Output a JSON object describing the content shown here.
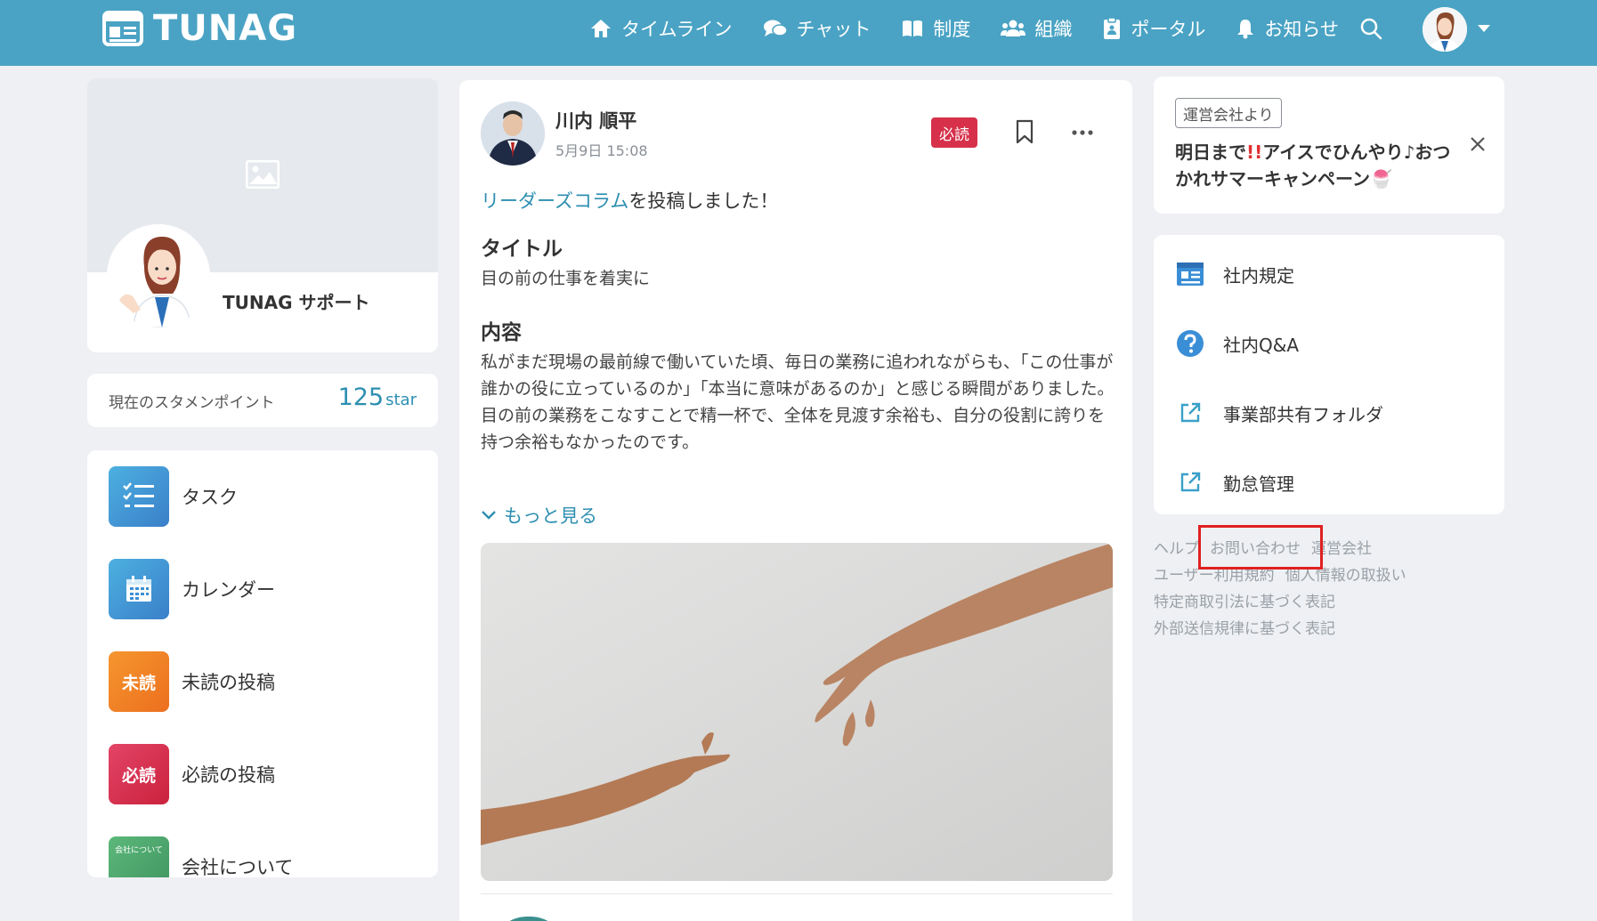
{
  "app": {
    "logo_text": "TUNAG"
  },
  "nav": {
    "items": [
      {
        "label": "タイムライン",
        "icon": "home-icon"
      },
      {
        "label": "チャット",
        "icon": "chat-icon"
      },
      {
        "label": "制度",
        "icon": "book-icon"
      },
      {
        "label": "組織",
        "icon": "people-icon"
      },
      {
        "label": "ポータル",
        "icon": "portal-icon"
      },
      {
        "label": "お知らせ",
        "icon": "bell-icon"
      }
    ]
  },
  "profile": {
    "name": "TUNAG サポート"
  },
  "points": {
    "label": "現在のスタメンポイント",
    "value": "125",
    "unit": "star"
  },
  "menu": {
    "items": [
      {
        "label": "タスク",
        "icon": "task-icon",
        "badge": "",
        "color": "#3d8fd1"
      },
      {
        "label": "カレンダー",
        "icon": "calendar-icon",
        "badge": "",
        "color": "#3a8ed6"
      },
      {
        "label": "未読の投稿",
        "icon": "unread-icon",
        "badge": "未読",
        "color": "#ef7d22"
      },
      {
        "label": "必読の投稿",
        "icon": "must-read-icon",
        "badge": "必読",
        "color": "#d6304a"
      },
      {
        "label": "会社について",
        "icon": "company-icon",
        "badge": "会社について",
        "color": "#4fa86b"
      }
    ]
  },
  "post": {
    "author": "川内 順平",
    "date": "5月9日 15:08",
    "must_badge": "必読",
    "intro_link": "リーダーズコラム",
    "intro_rest": "を投稿しました！",
    "title_heading": "タイトル",
    "title_text": "目の前の仕事を着実に",
    "content_heading": "内容",
    "content_text": "私がまだ現場の最前線で働いていた頃、毎日の業務に追われながらも、「この仕事が誰かの役に立っているのか」「本当に意味があるのか」と感じる瞬間がありました。目の前の業務をこなすことで精一杯で、全体を見渡す余裕も、自分の役割に誇りを持つ余裕もなかったのです。",
    "more_label": "もっと見る"
  },
  "notice": {
    "tag": "運営会社より",
    "text_pre": "明日まで",
    "text_bang": "!!",
    "text_post": "アイスでひんやり♪おつかれサマーキャンペーン🍧"
  },
  "links": {
    "items": [
      {
        "label": "社内規定",
        "icon": "document-icon"
      },
      {
        "label": "社内Q&A",
        "icon": "question-icon"
      },
      {
        "label": "事業部共有フォルダ",
        "icon": "external-link-icon"
      },
      {
        "label": "勤怠管理",
        "icon": "external-link-icon"
      }
    ]
  },
  "footer": {
    "row1": [
      "ヘルプ",
      "お問い合わせ",
      "運営会社"
    ],
    "row2": [
      "ユーザー利用規約",
      "個人情報の取扱い"
    ],
    "row3": [
      "特定商取引法に基づく表記"
    ],
    "row4": [
      "外部送信規律に基づく表記"
    ]
  },
  "colors": {
    "header": "#4aa3c4",
    "accent": "#2d8fb1",
    "must_read": "#d6304a"
  }
}
